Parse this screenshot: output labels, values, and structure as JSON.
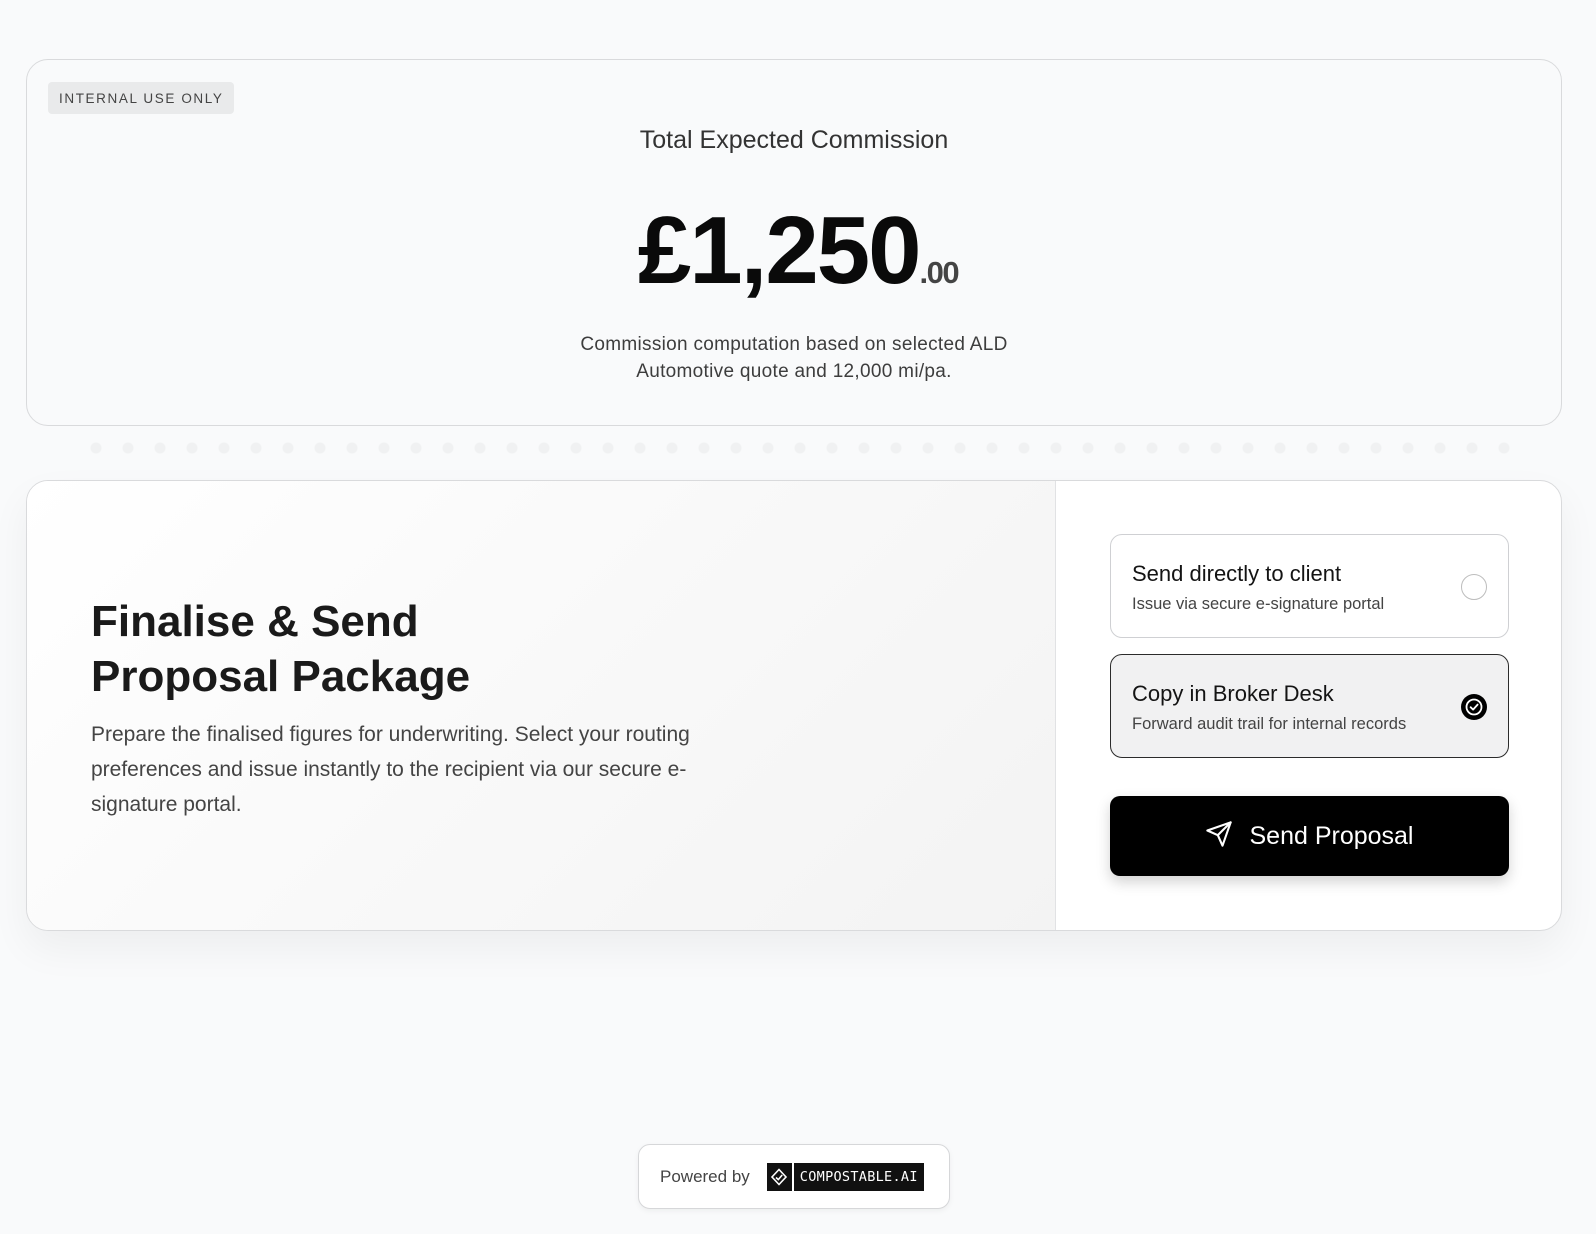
{
  "commission": {
    "badge": "INTERNAL USE ONLY",
    "title": "Total Expected Commission",
    "amount_main": "£1,250",
    "amount_decimal": ".00",
    "note_line1": "Commission computation based on selected ALD",
    "note_line2": "Automotive quote and 12,000 mi/pa."
  },
  "send": {
    "title_line1": "Finalise & Send",
    "title_line2": "Proposal Package",
    "description": "Prepare the finalised figures for underwriting. Select your routing preferences and issue instantly to the recipient via our secure e-signature portal.",
    "options": [
      {
        "title": "Send directly to client",
        "subtitle": "Issue via secure e-signature portal",
        "selected": false
      },
      {
        "title": "Copy in Broker Desk",
        "subtitle": "Forward audit trail for internal records",
        "selected": true
      }
    ],
    "button_label": "Send Proposal",
    "button_icon": "send-icon"
  },
  "footer": {
    "powered_label": "Powered by",
    "brand": "COMPOSTABLE.AI"
  }
}
